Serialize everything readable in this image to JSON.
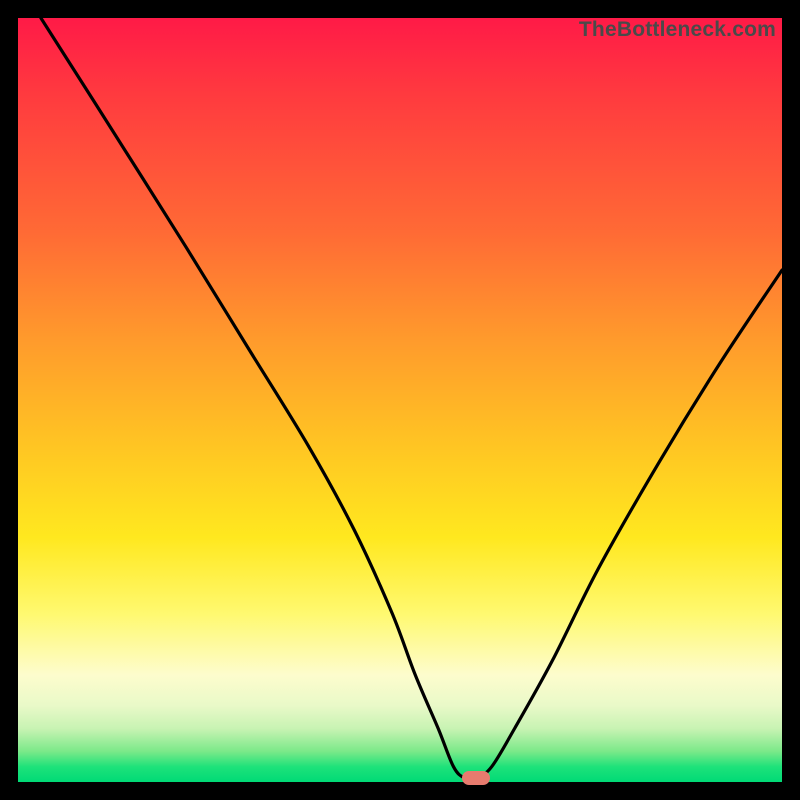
{
  "watermark": "TheBottleneck.com",
  "colors": {
    "frame": "#000000",
    "curve": "#000000",
    "marker": "#e77b6e",
    "gradient_stops": [
      "#ff1a47",
      "#ff3a3f",
      "#ff6a35",
      "#ff9a2c",
      "#ffc523",
      "#ffe81f",
      "#fff970",
      "#fdfccd",
      "#e9f9c8",
      "#c8f3b3",
      "#7be989",
      "#1ee27a",
      "#00da76"
    ]
  },
  "chart_data": {
    "type": "line",
    "title": "",
    "xlabel": "",
    "ylabel": "",
    "xlim": [
      0,
      100
    ],
    "ylim": [
      0,
      100
    ],
    "series": [
      {
        "name": "curve",
        "x": [
          3,
          10,
          22,
          30,
          38,
          44,
          49,
          52,
          55,
          57,
          58.5,
          60,
          62,
          65,
          70,
          76,
          84,
          92,
          100
        ],
        "y": [
          100,
          89,
          70,
          57,
          44,
          33,
          22,
          14,
          7,
          2,
          0.5,
          0.5,
          2,
          7,
          16,
          28,
          42,
          55,
          67
        ]
      }
    ],
    "marker": {
      "x": 60,
      "y": 0.5
    },
    "grid": false,
    "legend": false
  }
}
